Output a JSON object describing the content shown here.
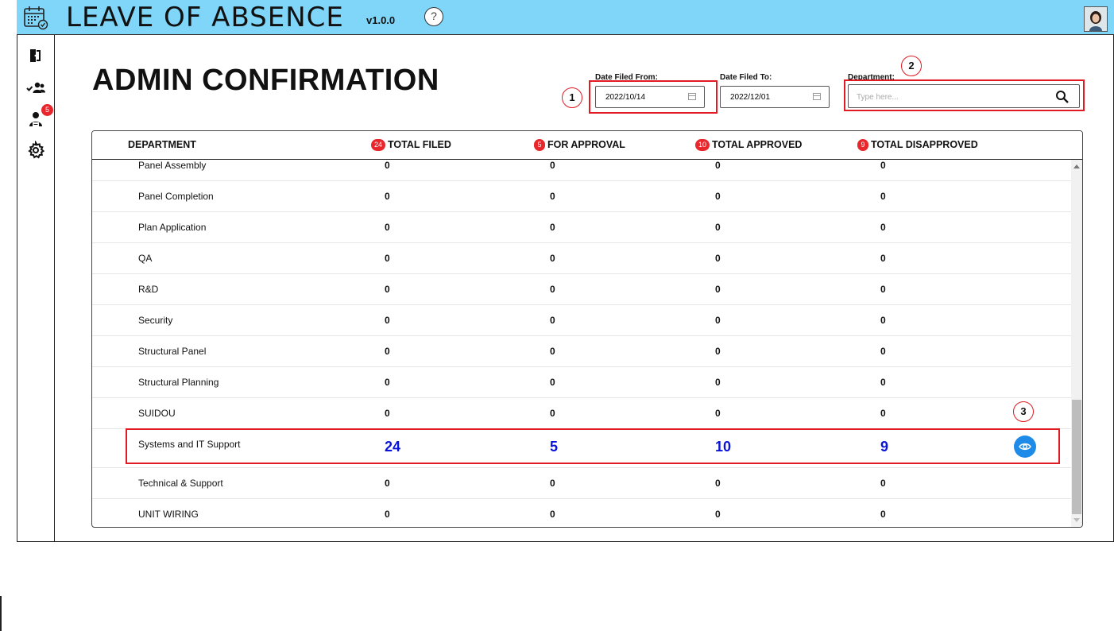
{
  "app": {
    "title": "LEAVE OF ABSENCE",
    "version": "v1.0.0",
    "help_label": "?"
  },
  "sidebar": {
    "items": [
      {
        "name": "exit-icon"
      },
      {
        "name": "users-check-icon"
      },
      {
        "name": "user-approval-icon",
        "badge": "5"
      },
      {
        "name": "gear-icon"
      }
    ]
  },
  "page": {
    "title": "ADMIN CONFIRMATION"
  },
  "filters": {
    "date_from_label": "Date Filed From:",
    "date_from_value": "2022/10/14",
    "date_to_label": "Date Filed To:",
    "date_to_value": "2022/12/01",
    "department_label": "Department:",
    "department_placeholder": "Type here..."
  },
  "annotations": [
    "1",
    "2",
    "3"
  ],
  "table": {
    "columns": [
      {
        "label": "DEPARTMENT",
        "count": ""
      },
      {
        "label": "TOTAL FILED",
        "count": "24"
      },
      {
        "label": "FOR APPROVAL",
        "count": "5"
      },
      {
        "label": "TOTAL APPROVED",
        "count": "10"
      },
      {
        "label": "TOTAL DISAPPROVED",
        "count": "9"
      }
    ],
    "rows": [
      {
        "department": "Panel Assembly",
        "filed": "0",
        "for_approval": "0",
        "approved": "0",
        "disapproved": "0"
      },
      {
        "department": "Panel Completion",
        "filed": "0",
        "for_approval": "0",
        "approved": "0",
        "disapproved": "0"
      },
      {
        "department": "Plan Application",
        "filed": "0",
        "for_approval": "0",
        "approved": "0",
        "disapproved": "0"
      },
      {
        "department": "QA",
        "filed": "0",
        "for_approval": "0",
        "approved": "0",
        "disapproved": "0"
      },
      {
        "department": "R&D",
        "filed": "0",
        "for_approval": "0",
        "approved": "0",
        "disapproved": "0"
      },
      {
        "department": "Security",
        "filed": "0",
        "for_approval": "0",
        "approved": "0",
        "disapproved": "0"
      },
      {
        "department": "Structural Panel",
        "filed": "0",
        "for_approval": "0",
        "approved": "0",
        "disapproved": "0"
      },
      {
        "department": "Structural Planning",
        "filed": "0",
        "for_approval": "0",
        "approved": "0",
        "disapproved": "0"
      },
      {
        "department": "SUIDOU",
        "filed": "0",
        "for_approval": "0",
        "approved": "0",
        "disapproved": "0"
      },
      {
        "department": "Systems and IT Support",
        "filed": "24",
        "for_approval": "5",
        "approved": "10",
        "disapproved": "9",
        "highlight": true
      },
      {
        "department": "Technical & Support",
        "filed": "0",
        "for_approval": "0",
        "approved": "0",
        "disapproved": "0"
      },
      {
        "department": "UNIT WIRING",
        "filed": "0",
        "for_approval": "0",
        "approved": "0",
        "disapproved": "0"
      }
    ]
  },
  "colors": {
    "header_bg": "#7fd6f9",
    "badge_red": "#e8262b",
    "highlight_blue": "#0a14d8",
    "view_button": "#1e8be8",
    "annotation_red": "#e01b24"
  }
}
